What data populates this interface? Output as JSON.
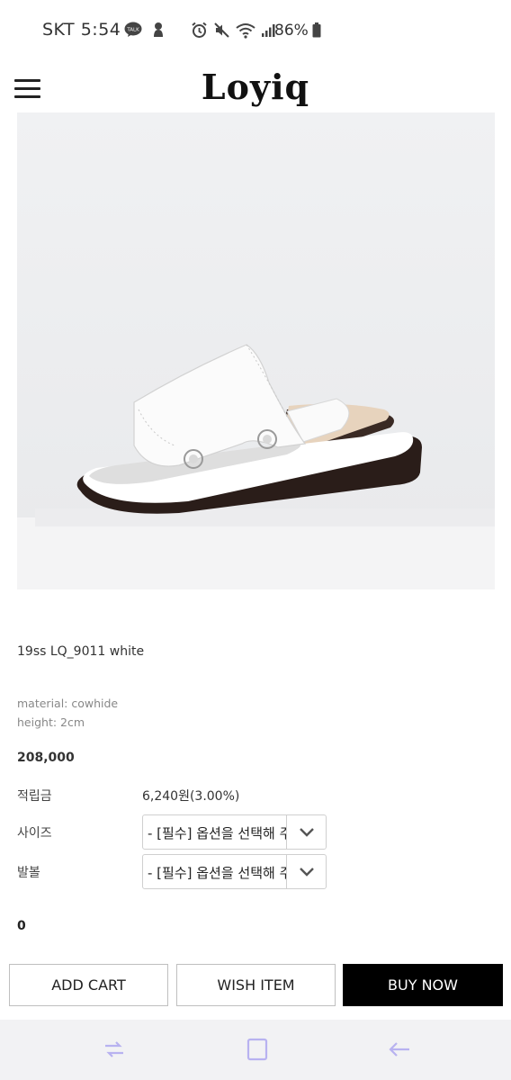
{
  "status_bar": {
    "carrier": "SKT",
    "time": "5:54",
    "battery": "86%",
    "icons": [
      "talk-icon",
      "mascot-icon",
      "alarm-icon",
      "mute-icon",
      "wifi-icon",
      "signal-icon",
      "battery-icon"
    ]
  },
  "header": {
    "logo": "Loyiq",
    "menu_icon": "hamburger-menu-icon"
  },
  "product": {
    "name": "19ss LQ_9011 white",
    "material": "material: cowhide",
    "height": "height: 2cm",
    "price": "208,000"
  },
  "options": {
    "points_label": "적립금",
    "points_value": "6,240원(3.00%)",
    "size_label": "사이즈",
    "size_selected": "- [필수] 옵션을 선택해 주세요 -",
    "width_label": "발볼",
    "width_selected": "- [필수] 옵션을 선택해 주세요 -"
  },
  "quantity_total": "0",
  "actions": {
    "add_cart": "ADD CART",
    "wish_item": "WISH ITEM",
    "buy_now": "BUY NOW"
  },
  "nav": {
    "recent_icon": "recent-apps-icon",
    "home_icon": "home-icon",
    "back_icon": "back-icon"
  },
  "colors": {
    "accent": "#000000",
    "nav_icon": "#b8b2f0"
  }
}
